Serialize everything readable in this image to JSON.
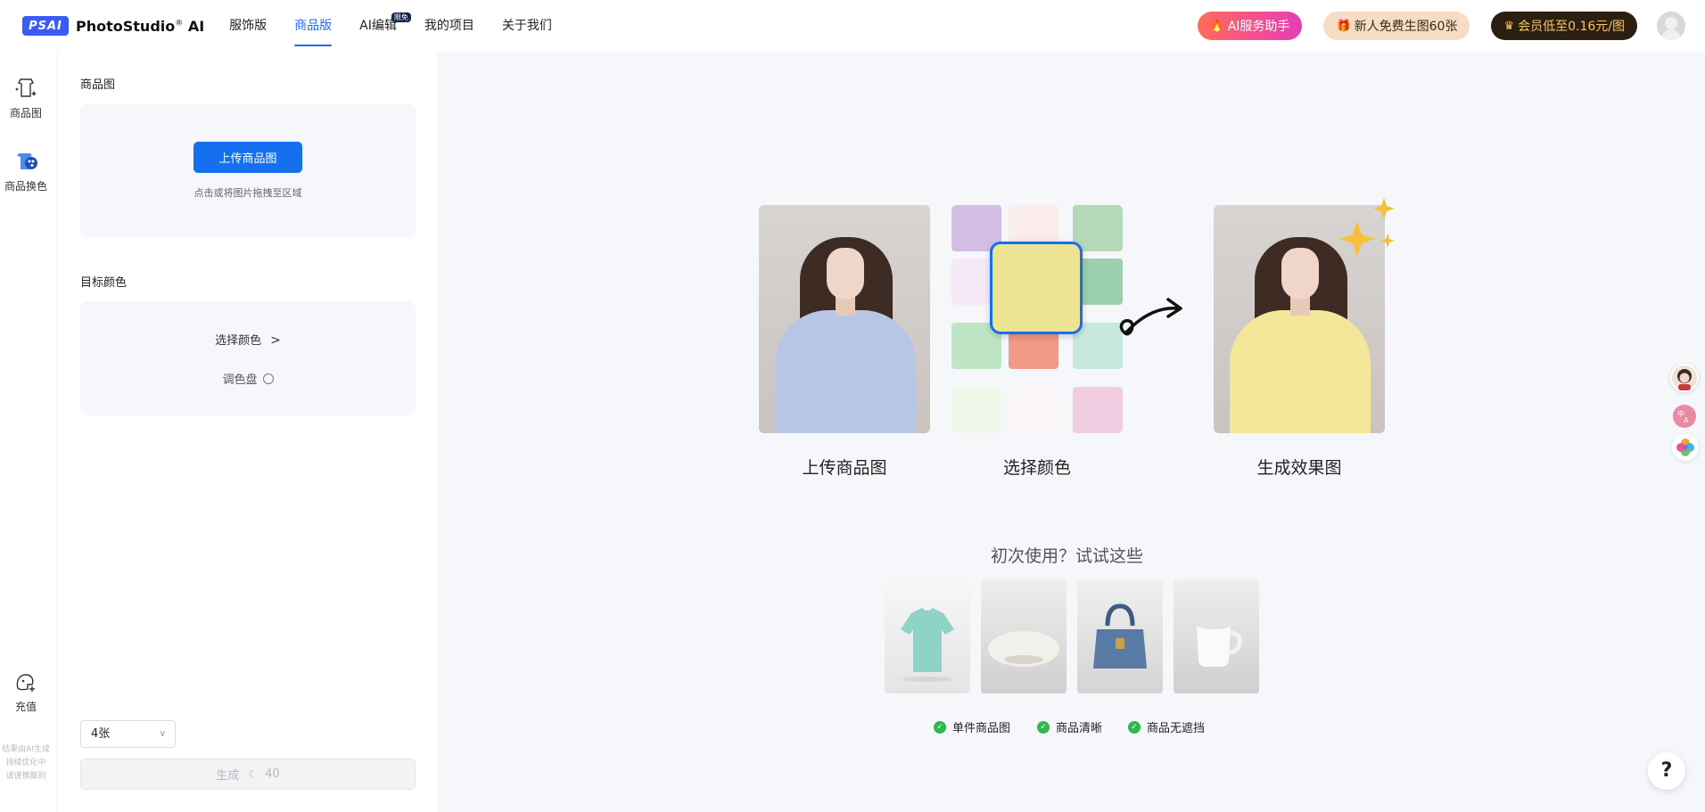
{
  "header": {
    "logo_mark": "PSAI",
    "logo_text": "PhotoStudio",
    "logo_suffix": "AI",
    "nav": [
      {
        "label": "服饰版"
      },
      {
        "label": "商品版"
      },
      {
        "label": "AI编辑",
        "badge": "限免"
      },
      {
        "label": "我的项目"
      },
      {
        "label": "关于我们"
      }
    ],
    "ai_assistant": "AI服务助手",
    "free_gift": "新人免费生图60张",
    "vip": "会员低至0.16元/图"
  },
  "rail": {
    "product_image": "商品图",
    "recolor": "商品换色",
    "recharge": "充值",
    "note_lines": [
      "结果由AI生成",
      "持续优化中",
      "请谨慎甄别"
    ]
  },
  "panel": {
    "product_title": "商品图",
    "upload_button": "上传商品图",
    "upload_hint": "点击或将图片拖拽至区域",
    "color_title": "目标颜色",
    "choose_color": "选择颜色",
    "palette": "调色盘",
    "count_value": "4张",
    "generate_label": "生成",
    "generate_cost": "40"
  },
  "stage": {
    "steps": [
      "上传商品图",
      "选择颜色",
      "生成效果图"
    ],
    "try_title": "初次使用？试试这些",
    "samples": [
      "t-shirt",
      "beret",
      "handbag",
      "mug"
    ],
    "checks": [
      "单件商品图",
      "商品清晰",
      "商品无遮挡"
    ],
    "help": "?"
  },
  "colors": {
    "accent": "#1570ef",
    "stage_bg": "#f5f7fb",
    "swatch_selected": "#ece493",
    "grid_swatches": [
      "#d3bde3",
      "#f9eceb",
      "#b5d9b8",
      "#f6eaf8",
      "#ece493",
      "#9dd0ae",
      "#bfe6c4",
      "#f19a87",
      "#c7e8dd",
      "#f1f8ea",
      "#fbf6f6",
      "#f1cde1"
    ]
  }
}
